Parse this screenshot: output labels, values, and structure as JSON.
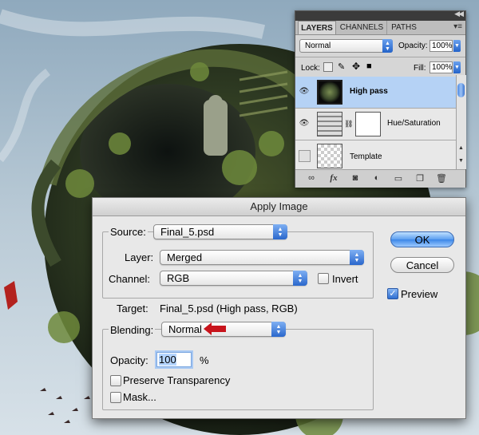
{
  "layers_panel": {
    "tabs": [
      "LAYERS",
      "CHANNELS",
      "PATHS"
    ],
    "blend_mode": "Normal",
    "opacity_label": "Opacity:",
    "opacity_value": "100%",
    "lock_label": "Lock:",
    "fill_label": "Fill:",
    "fill_value": "100%",
    "layers": [
      {
        "name": "High pass",
        "selected": true,
        "visible": true
      },
      {
        "name": "Hue/Saturation",
        "selected": false,
        "visible": true
      },
      {
        "name": "Template",
        "selected": false,
        "visible": false
      }
    ]
  },
  "dialog": {
    "title": "Apply Image",
    "source_label": "Source:",
    "source_value": "Final_5.psd",
    "layer_label": "Layer:",
    "layer_value": "Merged",
    "channel_label": "Channel:",
    "channel_value": "RGB",
    "invert_label": "Invert",
    "invert_checked": false,
    "target_label": "Target:",
    "target_value": "Final_5.psd (High pass, RGB)",
    "blending_label": "Blending:",
    "blending_value": "Normal",
    "opacity_label": "Opacity:",
    "opacity_value": "100",
    "opacity_unit": "%",
    "preserve_label": "Preserve Transparency",
    "preserve_checked": false,
    "mask_label": "Mask...",
    "mask_checked": false,
    "ok_label": "OK",
    "cancel_label": "Cancel",
    "preview_label": "Preview",
    "preview_checked": true
  },
  "colors": {
    "accent_blue": "#3c86e8",
    "selected_layer": "#b5d2f5",
    "annotation_arrow": "#c8141c"
  }
}
